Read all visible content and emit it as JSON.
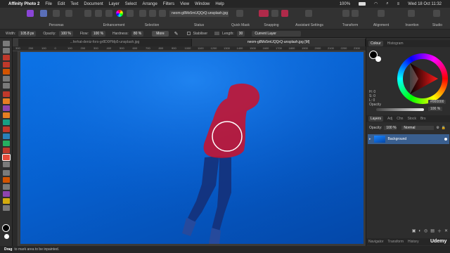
{
  "menubar": {
    "app_name": "Affinity Photo 2",
    "items": [
      "File",
      "Edit",
      "Text",
      "Document",
      "Layer",
      "Select",
      "Arrange",
      "Filters",
      "View",
      "Window",
      "Help"
    ],
    "battery": "100%",
    "datetime": "Wed 18 Oct 11:32"
  },
  "toolbar": {
    "personas": "Personas",
    "enhancement": "Enhancement",
    "selection": "Selection",
    "status": "Status",
    "quick_mask": "Quick Mask",
    "snapping": "Snapping",
    "assistant": "Assistant Settings",
    "transform": "Transform",
    "alignment": "Alignment",
    "insertion": "Insertion",
    "studio": "Studio",
    "doc_name": "neom-g8Mx5mUQQrQ-unsplash.jpg"
  },
  "context": {
    "width_label": "Width:",
    "width_value": "105.8 px",
    "opacity_label": "Opacity:",
    "opacity_value": "100 %",
    "flow_label": "Flow:",
    "flow_value": "100 %",
    "hardness_label": "Hardness:",
    "hardness_value": "80 %",
    "more_label": "More",
    "stabiliser_label": "Stabiliser",
    "length_label": "Length:",
    "length_value": "30",
    "layer_label": "Current Layer"
  },
  "doc_tabs": [
    "...ferhat-deniz-fors-gr8D0PMp5-unsplash.jpg",
    "neom-g8Mx5mUQQrQ-unsplash.jpg [M]"
  ],
  "ruler_ticks": [
    "300",
    "200",
    "100",
    "0",
    "100",
    "200",
    "300",
    "400",
    "500",
    "600",
    "700",
    "800",
    "900",
    "1000",
    "1100",
    "1200",
    "1300",
    "1400",
    "1500",
    "1600",
    "1700",
    "1800",
    "1900",
    "2000",
    "2100",
    "2200",
    "2300"
  ],
  "colour_panel": {
    "tabs": [
      "Colour",
      "Histogram"
    ],
    "h": "H: 0",
    "s": "S: 0",
    "l": "L: 0",
    "hex": "000000",
    "opacity_label": "Opacity",
    "opacity_value": "100 %"
  },
  "layers_panel": {
    "tabs": [
      "Layers",
      "Adj",
      "Chn",
      "Stock",
      "Brs"
    ],
    "opacity_label": "Opacity:",
    "opacity_value": "100 %",
    "blend_mode": "Normal",
    "layer_name": "Background"
  },
  "bottom_tabs": [
    "Navigator",
    "Transform",
    "History"
  ],
  "status": {
    "bold": "Drag",
    "text": "to mark area to be inpainted."
  },
  "watermark": "Udemy",
  "colors": {
    "accent": "#0a74e8",
    "mask_red": "#c8122d",
    "selected_layer": "#3a5f8f"
  }
}
